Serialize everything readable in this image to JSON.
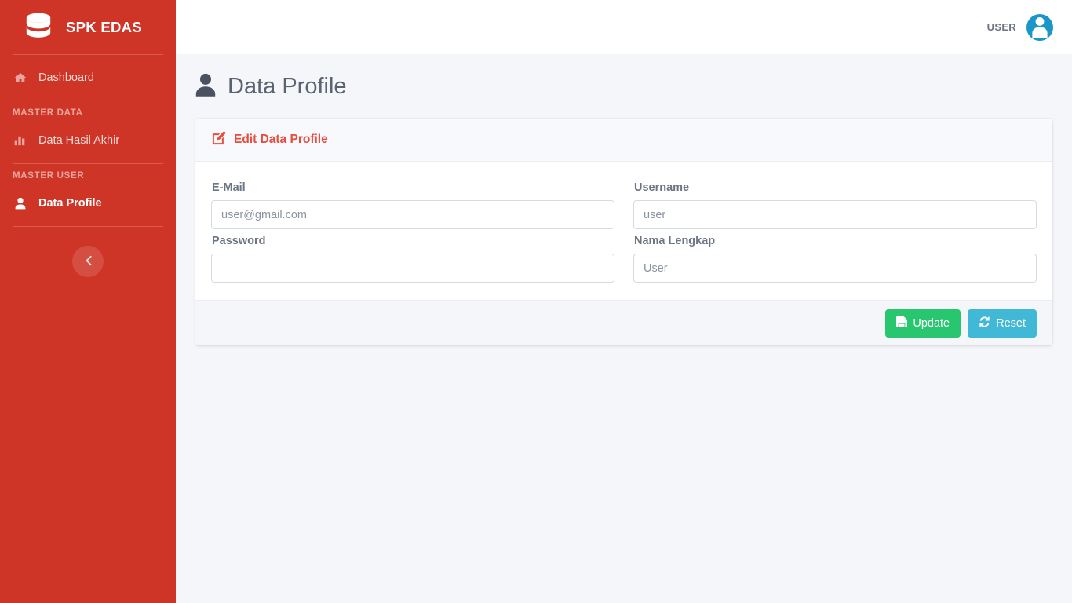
{
  "brand": {
    "name": "SPK EDAS",
    "logo_icon": "database-icon"
  },
  "sidebar": {
    "items": [
      {
        "label": "Dashboard",
        "icon": "home-icon",
        "active": false
      },
      {
        "label": "Data Hasil Akhir",
        "icon": "bar-chart-icon",
        "active": false
      },
      {
        "label": "Data Profile",
        "icon": "user-icon",
        "active": true
      }
    ],
    "headings": {
      "master_data": "MASTER DATA",
      "master_user": "MASTER USER"
    },
    "collapse_icon": "chevron-left-icon"
  },
  "topbar": {
    "user_label": "USER",
    "avatar_icon": "user-avatar-icon"
  },
  "page": {
    "title": "Data Profile",
    "title_icon": "user-icon"
  },
  "card": {
    "header_title": "Edit Data Profile",
    "header_icon": "edit-pencil-square-icon",
    "fields": {
      "email": {
        "label": "E-Mail",
        "value": "",
        "placeholder": "user@gmail.com"
      },
      "username": {
        "label": "Username",
        "value": "",
        "placeholder": "user"
      },
      "password": {
        "label": "Password",
        "value": "",
        "placeholder": ""
      },
      "fullname": {
        "label": "Nama Lengkap",
        "value": "",
        "placeholder": "User"
      }
    },
    "buttons": {
      "update": {
        "label": "Update",
        "icon": "save-floppy-icon"
      },
      "reset": {
        "label": "Reset",
        "icon": "refresh-sync-icon"
      }
    }
  },
  "colors": {
    "sidebar_red": "#ce3526",
    "accent_red": "#e74c3c",
    "update_green": "#28c76f",
    "reset_blue": "#41b8d5",
    "avatar_blue": "#1a97c8",
    "content_bg": "#f4f6f9"
  }
}
